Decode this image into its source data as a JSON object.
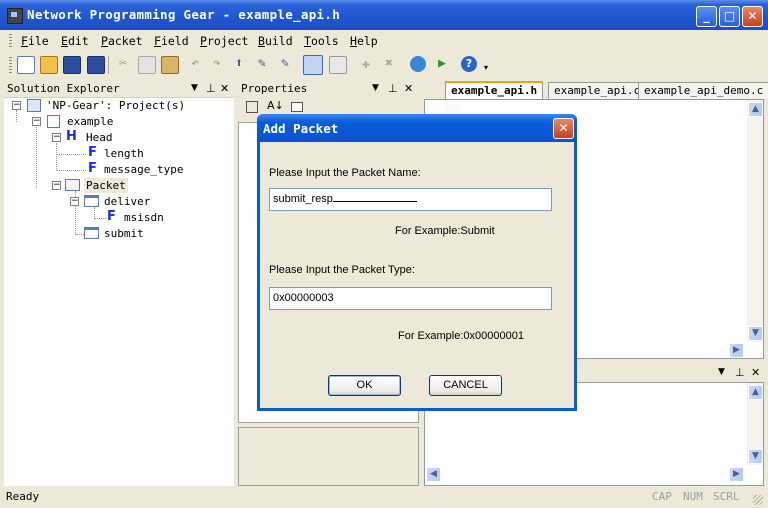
{
  "window": {
    "title": "Network Programming Gear - example_api.h"
  },
  "menu": [
    "File",
    "Edit",
    "Packet",
    "Field",
    "Project",
    "Build",
    "Tools",
    "Help"
  ],
  "solution_explorer": {
    "header": "Solution Explorer",
    "tree": {
      "root": "'NP-Gear': Project(s)",
      "project": "example",
      "head": "Head",
      "head_fields": [
        "length",
        "message_type"
      ],
      "packet": "Packet",
      "deliver": "deliver",
      "deliver_fields": [
        "msisdn"
      ],
      "submit": "submit"
    }
  },
  "properties": {
    "header": "Properties"
  },
  "editor": {
    "tabs": [
      "example_api.h",
      "example_api.c",
      "example_api_demo.c"
    ]
  },
  "dialog": {
    "title": "Add Packet",
    "name_label": "Please Input the Packet Name:",
    "name_value": "submit_resp",
    "name_example": "For Example:Submit",
    "type_label": "Please Input the Packet Type:",
    "type_value": "0x00000003",
    "type_example": "For Example:0x00000001",
    "ok_label": "OK",
    "cancel_label": "CANCEL"
  },
  "status": {
    "text": "Ready",
    "indicators": [
      "CAP",
      "NUM",
      "SCRL"
    ]
  }
}
